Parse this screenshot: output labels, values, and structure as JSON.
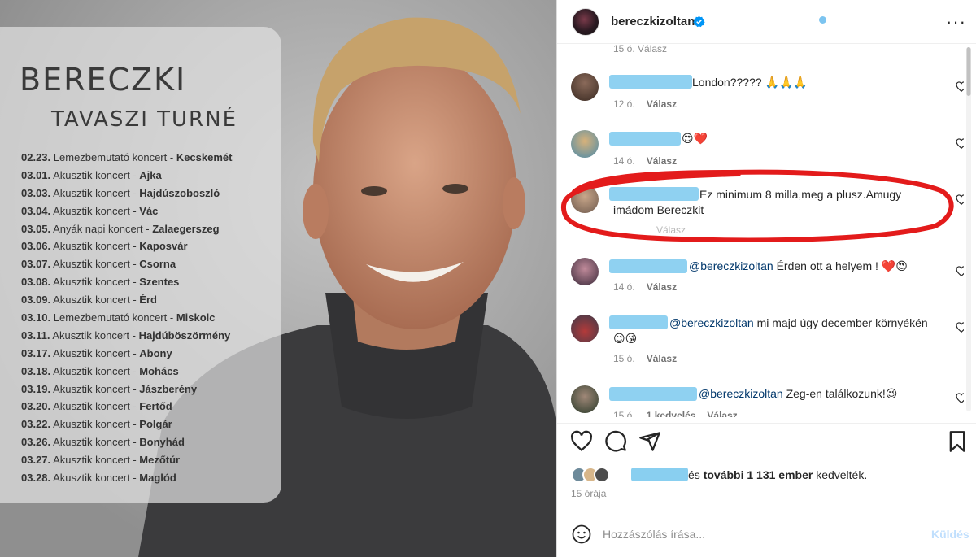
{
  "poster": {
    "brand": "BERECZKI",
    "subtitle": "TAVASZI TURNÉ",
    "dates": [
      {
        "date": "02.23.",
        "type": "Lemezbemutató koncert -",
        "city": "Kecskemét"
      },
      {
        "date": "03.01.",
        "type": "Akusztik koncert -",
        "city": "Ajka"
      },
      {
        "date": "03.03.",
        "type": "Akusztik koncert -",
        "city": "Hajdúszoboszló"
      },
      {
        "date": "03.04.",
        "type": "Akusztik koncert -",
        "city": "Vác"
      },
      {
        "date": "03.05.",
        "type": "Anyák napi koncert -",
        "city": "Zalaegerszeg"
      },
      {
        "date": "03.06.",
        "type": "Akusztik koncert -",
        "city": "Kaposvár"
      },
      {
        "date": "03.07.",
        "type": "Akusztik koncert -",
        "city": "Csorna"
      },
      {
        "date": "03.08.",
        "type": "Akusztik koncert -",
        "city": "Szentes"
      },
      {
        "date": "03.09.",
        "type": "Akusztik koncert -",
        "city": "Érd"
      },
      {
        "date": "03.10.",
        "type": "Lemezbemutató koncert -",
        "city": "Miskolc"
      },
      {
        "date": "03.11.",
        "type": "Akusztik koncert -",
        "city": "Hajdúböszörmény"
      },
      {
        "date": "03.17.",
        "type": "Akusztik koncert -",
        "city": "Abony"
      },
      {
        "date": "03.18.",
        "type": "Akusztik koncert -",
        "city": "Mohács"
      },
      {
        "date": "03.19.",
        "type": "Akusztik koncert -",
        "city": "Jászberény"
      },
      {
        "date": "03.20.",
        "type": "Akusztik koncert -",
        "city": "Fertőd"
      },
      {
        "date": "03.22.",
        "type": "Akusztik koncert -",
        "city": "Polgár"
      },
      {
        "date": "03.26.",
        "type": "Akusztik koncert -",
        "city": "Bonyhád"
      },
      {
        "date": "03.27.",
        "type": "Akusztik koncert -",
        "city": "Mezőtúr"
      },
      {
        "date": "03.28.",
        "type": "Akusztik koncert -",
        "city": "Maglód"
      }
    ]
  },
  "header": {
    "username": "bereczkizoltan",
    "verified_icon": "verified-badge-icon",
    "more_label": "···"
  },
  "comments": {
    "partial_top_meta": "15 ó.   Válasz",
    "reply_label": "Válasz",
    "items": [
      {
        "text": "London????? 🙏🙏🙏",
        "time": "12 ó.",
        "likes": ""
      },
      {
        "text": "😍❤️",
        "time": "14 ó.",
        "likes": ""
      },
      {
        "text": "Ez minimum 8 milla,meg a plusz.Amugy imádom Bereczkit",
        "time": "",
        "likes": "",
        "reply": "Válasz"
      },
      {
        "mention": "@bereczkizoltan",
        "text": "Érden ott a helyem ! ❤️😍",
        "time": "14 ó.",
        "likes": ""
      },
      {
        "mention": "@bereczkizoltan",
        "text": "mi majd úgy december környékén",
        "text2": "😉😘",
        "time": "15 ó.",
        "likes": ""
      },
      {
        "mention": "@bereczkizoltan",
        "text": "Zeg-en találkozunk!😉",
        "time": "15 ó.",
        "likes": "1 kedvelés",
        "reply": "Válasz"
      }
    ]
  },
  "likes_line": {
    "prefix": "és",
    "others": "további 1 131 ember",
    "suffix": "kedvelték."
  },
  "timestamp": "15 órája",
  "composer": {
    "placeholder": "Hozzászólás írása...",
    "post_label": "Küldés"
  },
  "colors": {
    "link": "#00376b",
    "muted": "#8e8e8e",
    "redaction": "#89cff0",
    "annotation": "#e31b1b"
  }
}
